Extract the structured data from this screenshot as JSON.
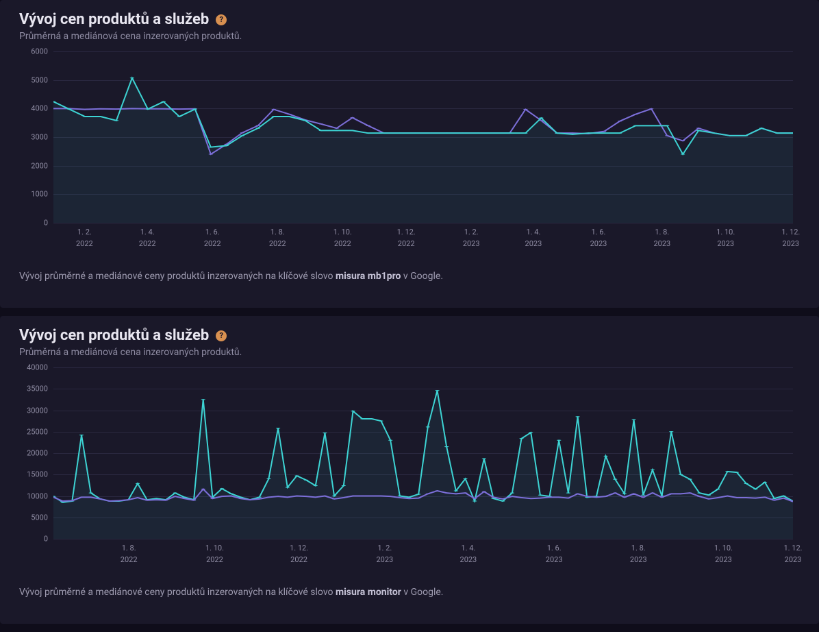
{
  "panels": [
    {
      "title": "Vývoj cen produktů a služeb",
      "subtitle": "Průměrná a mediánová cena inzerovaných produktů.",
      "footer_prefix": "Vývoj průměrné a mediánové ceny produktů inzerovaných na klíčové slovo ",
      "footer_keyword": "misura mb1pro",
      "footer_suffix": " v Google."
    },
    {
      "title": "Vývoj cen produktů a služeb",
      "subtitle": "Průměrná a mediánová cena inzerovaných produktů.",
      "footer_prefix": "Vývoj průměrné a mediánové ceny produktů inzerovaných na klíčové slovo ",
      "footer_keyword": "misura monitor",
      "footer_suffix": " v Google."
    }
  ],
  "chart_data": [
    {
      "type": "line",
      "title": "Vývoj cen produktů a služeb",
      "xlabel": "",
      "ylabel": "",
      "ylim": [
        0,
        6000
      ],
      "y_ticks": [
        0,
        1000,
        2000,
        3000,
        4000,
        5000,
        6000
      ],
      "x_ticks": [
        {
          "label_top": "1. 2.",
          "label_bottom": "2022",
          "pos": 0.042
        },
        {
          "label_top": "1. 4.",
          "label_bottom": "2022",
          "pos": 0.127
        },
        {
          "label_top": "1. 6.",
          "label_bottom": "2022",
          "pos": 0.215
        },
        {
          "label_top": "1. 8.",
          "label_bottom": "2022",
          "pos": 0.303
        },
        {
          "label_top": "1. 10.",
          "label_bottom": "2022",
          "pos": 0.391
        },
        {
          "label_top": "1. 12.",
          "label_bottom": "2022",
          "pos": 0.477
        },
        {
          "label_top": "1. 2.",
          "label_bottom": "2023",
          "pos": 0.565
        },
        {
          "label_top": "1. 4.",
          "label_bottom": "2023",
          "pos": 0.649
        },
        {
          "label_top": "1. 6.",
          "label_bottom": "2023",
          "pos": 0.737
        },
        {
          "label_top": "1. 8.",
          "label_bottom": "2023",
          "pos": 0.823
        },
        {
          "label_top": "1. 10.",
          "label_bottom": "2023",
          "pos": 0.909
        },
        {
          "label_top": "1. 12.",
          "label_bottom": "2023",
          "pos": 0.997
        }
      ],
      "n_points": 48,
      "series": [
        {
          "name": "median",
          "color": "#7c6fd9",
          "fill": "none",
          "values": [
            4000,
            4000,
            3970,
            3990,
            3980,
            4000,
            3990,
            3990,
            3980,
            3990,
            2400,
            2750,
            3150,
            3400,
            3970,
            3800,
            3600,
            3460,
            3310,
            3680,
            3400,
            3140,
            3140,
            3140,
            3140,
            3140,
            3140,
            3140,
            3140,
            3140,
            3970,
            3580,
            3140,
            3140,
            3120,
            3200,
            3560,
            3800,
            3990,
            3050,
            2870,
            3310,
            3140,
            3050,
            3050,
            3310,
            3140,
            3140
          ]
        },
        {
          "name": "average",
          "color": "#3dd3d3",
          "fill": "rgba(61,211,211,0.07)",
          "values": [
            4240,
            3980,
            3720,
            3720,
            3580,
            5070,
            3980,
            4240,
            3720,
            3980,
            2650,
            2700,
            3050,
            3310,
            3720,
            3720,
            3580,
            3230,
            3230,
            3230,
            3140,
            3140,
            3140,
            3140,
            3140,
            3140,
            3140,
            3140,
            3140,
            3140,
            3140,
            3670,
            3140,
            3100,
            3140,
            3140,
            3140,
            3400,
            3400,
            3400,
            2400,
            3230,
            3140,
            3050,
            3050,
            3310,
            3140,
            3140
          ]
        }
      ]
    },
    {
      "type": "line",
      "title": "Vývoj cen produktů a služeb",
      "xlabel": "",
      "ylabel": "",
      "ylim": [
        0,
        40000
      ],
      "y_ticks": [
        0,
        5000,
        10000,
        15000,
        20000,
        25000,
        30000,
        35000,
        40000
      ],
      "x_ticks": [
        {
          "label_top": "1. 8.",
          "label_bottom": "2022",
          "pos": 0.102
        },
        {
          "label_top": "1. 10.",
          "label_bottom": "2022",
          "pos": 0.218
        },
        {
          "label_top": "1. 12.",
          "label_bottom": "2022",
          "pos": 0.332
        },
        {
          "label_top": "1. 2.",
          "label_bottom": "2023",
          "pos": 0.448
        },
        {
          "label_top": "1. 4.",
          "label_bottom": "2023",
          "pos": 0.561
        },
        {
          "label_top": "1. 6.",
          "label_bottom": "2023",
          "pos": 0.677
        },
        {
          "label_top": "1. 8.",
          "label_bottom": "2023",
          "pos": 0.791
        },
        {
          "label_top": "1. 10.",
          "label_bottom": "2023",
          "pos": 0.906
        },
        {
          "label_top": "1. 12.",
          "label_bottom": "2023",
          "pos": 1.0
        }
      ],
      "n_points": 80,
      "series": [
        {
          "name": "average",
          "color": "#3dd3d3",
          "fill": "rgba(61,211,211,0.07)",
          "values": [
            9900,
            8500,
            8800,
            24200,
            10700,
            9300,
            8800,
            8800,
            9100,
            12900,
            9100,
            9400,
            9100,
            10700,
            9700,
            9100,
            32500,
            9700,
            11700,
            10500,
            9700,
            9100,
            9700,
            14000,
            25800,
            12000,
            14700,
            13700,
            12400,
            24700,
            10000,
            12400,
            29800,
            28000,
            28000,
            27500,
            23000,
            10000,
            9700,
            10400,
            26100,
            34600,
            21500,
            11200,
            14000,
            8800,
            18700,
            9400,
            8800,
            10700,
            23400,
            24800,
            10200,
            9900,
            23000,
            10700,
            28500,
            9700,
            9900,
            19300,
            13900,
            10500,
            27800,
            10200,
            16100,
            10000,
            25000,
            15000,
            13900,
            10700,
            10200,
            11600,
            15700,
            15500,
            12900,
            11600,
            13200,
            9400,
            10000,
            8800
          ]
        },
        {
          "name": "median",
          "color": "#7c6fd9",
          "fill": "none",
          "values": [
            9700,
            8800,
            8900,
            9700,
            9700,
            9300,
            8800,
            8900,
            9100,
            9600,
            9000,
            9100,
            9000,
            9900,
            9400,
            9000,
            11600,
            9400,
            9900,
            10000,
            9400,
            9100,
            9300,
            9700,
            9900,
            9700,
            10000,
            9900,
            9700,
            10000,
            9300,
            9600,
            10000,
            10000,
            10000,
            10000,
            9900,
            9600,
            9400,
            9500,
            10500,
            11200,
            10700,
            10500,
            10700,
            9400,
            11000,
            9700,
            9300,
            9900,
            9600,
            9400,
            9500,
            9700,
            9700,
            9500,
            10500,
            9900,
            9700,
            9900,
            10700,
            9700,
            10500,
            9700,
            10700,
            9700,
            10500,
            10500,
            10700,
            9900,
            9300,
            9600,
            10000,
            9600,
            9600,
            9500,
            9700,
            9000,
            9500,
            8700
          ]
        }
      ]
    }
  ]
}
